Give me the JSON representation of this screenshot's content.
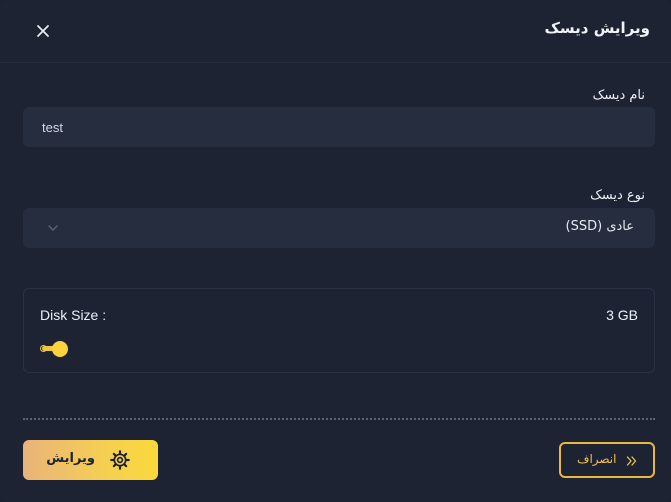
{
  "dialog": {
    "title": "ویرایش دیسک"
  },
  "fields": {
    "name_label": "نام دیسک",
    "name_value": "test",
    "type_label": "نوع دیسک",
    "type_value": "عادی (SSD)"
  },
  "disk_size": {
    "label": "Disk Size :",
    "value_text": "3 GB",
    "slider_fraction": 0.01
  },
  "actions": {
    "save_label": "ویرایش",
    "cancel_label": "انصراف"
  },
  "icons": {
    "close": "close-icon",
    "chevron": "chevron-down-icon",
    "save": "gear-icon",
    "cancel": "double-chevron-right-icon"
  },
  "colors": {
    "background": "#1d2333",
    "input_bg": "#262d3f",
    "accent": "#f3c53a",
    "accent_border": "#e8b740"
  }
}
